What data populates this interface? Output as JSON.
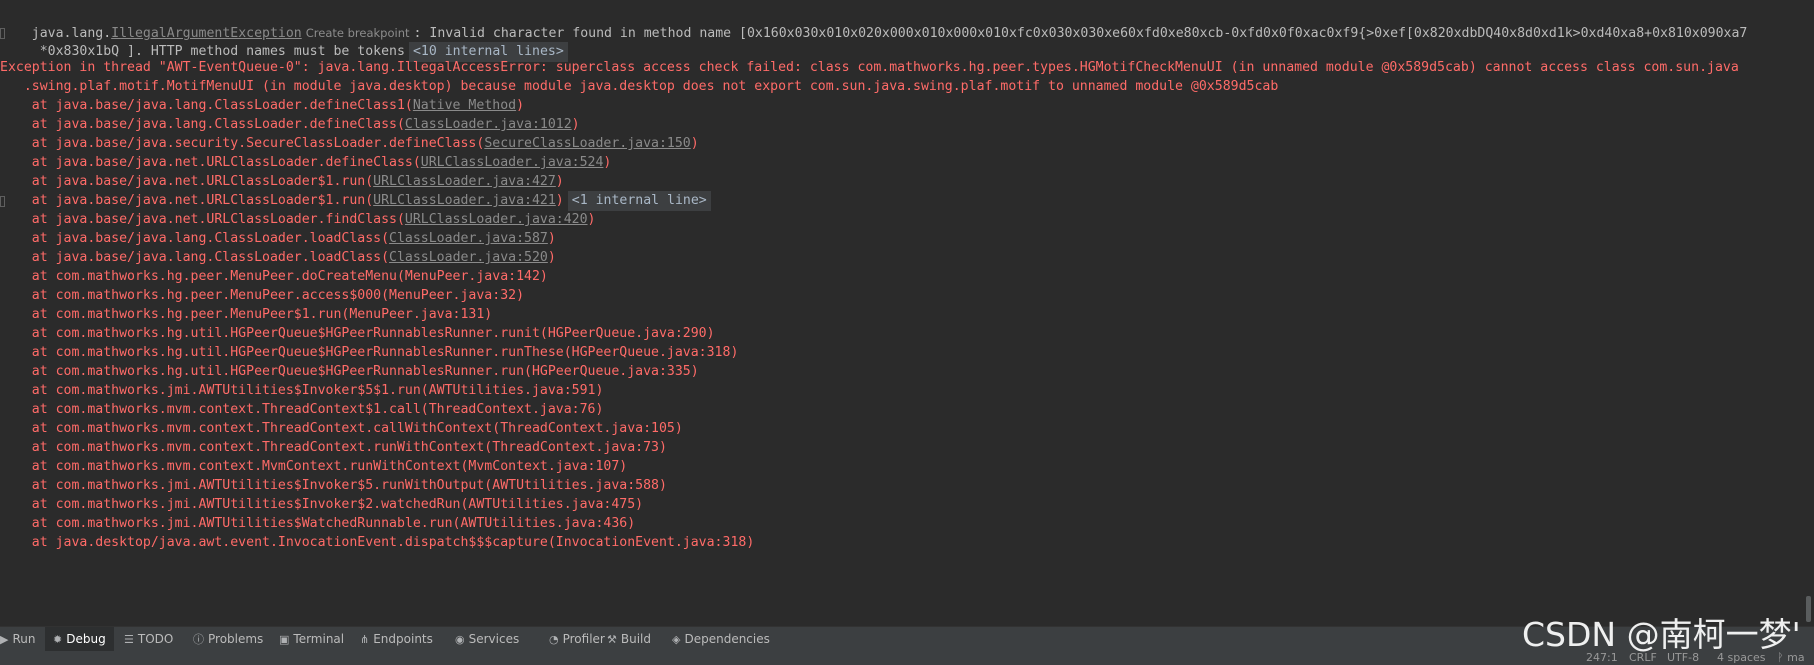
{
  "console": {
    "line1": {
      "prefix": "java.lang.",
      "exception_link": "IllegalArgumentException",
      "breakpoint_label": "Create breakpoint",
      "message": ": Invalid character found in method name [0x160x030x010x020x000x010x000x010xfc0x030x030xe60xfd0xe80xcb-0xfd0x0f0xac0xf9{>0xef[0x820xdbDQ40x8d0xd1k>0xd40xa8+0x810x090xa7"
    },
    "line2": {
      "text": " *0x830x1bQ ]. HTTP method names must be tokens",
      "internal_chip": "<10 internal lines>"
    },
    "exception_line1": "Exception in thread \"AWT-EventQueue-0\": java.lang.IllegalAccessError: superclass access check failed: class com.mathworks.hg.peer.types.HGMotifCheckMenuUI (in unnamed module @0x589d5cab) cannot access class com.sun.java",
    "exception_line2": "   .swing.plaf.motif.MotifMenuUI (in module java.desktop) because module java.desktop does not export com.sun.java.swing.plaf.motif to unnamed module @0x589d5cab",
    "stack": [
      {
        "pre": "    at java.base/java.lang.ClassLoader.defineClass1(",
        "link": "Native Method",
        "post": ")"
      },
      {
        "pre": "    at java.base/java.lang.ClassLoader.defineClass(",
        "link": "ClassLoader.java:1012",
        "post": ")"
      },
      {
        "pre": "    at java.base/java.security.SecureClassLoader.defineClass(",
        "link": "SecureClassLoader.java:150",
        "post": ")"
      },
      {
        "pre": "    at java.base/java.net.URLClassLoader.defineClass(",
        "link": "URLClassLoader.java:524",
        "post": ")"
      },
      {
        "pre": "    at java.base/java.net.URLClassLoader$1.run(",
        "link": "URLClassLoader.java:427",
        "post": ")"
      },
      {
        "pre": "    at java.base/java.net.URLClassLoader$1.run(",
        "link": "URLClassLoader.java:421",
        "post": ")",
        "chip": "<1 internal line>"
      },
      {
        "pre": "    at java.base/java.net.URLClassLoader.findClass(",
        "link": "URLClassLoader.java:420",
        "post": ")"
      },
      {
        "pre": "    at java.base/java.lang.ClassLoader.loadClass(",
        "link": "ClassLoader.java:587",
        "post": ")"
      },
      {
        "pre": "    at java.base/java.lang.ClassLoader.loadClass(",
        "link": "ClassLoader.java:520",
        "post": ")"
      },
      {
        "pre": "    at com.mathworks.hg.peer.MenuPeer.doCreateMenu(MenuPeer.java:142)"
      },
      {
        "pre": "    at com.mathworks.hg.peer.MenuPeer.access$000(MenuPeer.java:32)"
      },
      {
        "pre": "    at com.mathworks.hg.peer.MenuPeer$1.run(MenuPeer.java:131)"
      },
      {
        "pre": "    at com.mathworks.hg.util.HGPeerQueue$HGPeerRunnablesRunner.runit(HGPeerQueue.java:290)"
      },
      {
        "pre": "    at com.mathworks.hg.util.HGPeerQueue$HGPeerRunnablesRunner.runThese(HGPeerQueue.java:318)"
      },
      {
        "pre": "    at com.mathworks.hg.util.HGPeerQueue$HGPeerRunnablesRunner.run(HGPeerQueue.java:335)"
      },
      {
        "pre": "    at com.mathworks.jmi.AWTUtilities$Invoker$5$1.run(AWTUtilities.java:591)"
      },
      {
        "pre": "    at com.mathworks.mvm.context.ThreadContext$1.call(ThreadContext.java:76)"
      },
      {
        "pre": "    at com.mathworks.mvm.context.ThreadContext.callWithContext(ThreadContext.java:105)"
      },
      {
        "pre": "    at com.mathworks.mvm.context.ThreadContext.runWithContext(ThreadContext.java:73)"
      },
      {
        "pre": "    at com.mathworks.mvm.context.MvmContext.runWithContext(MvmContext.java:107)"
      },
      {
        "pre": "    at com.mathworks.jmi.AWTUtilities$Invoker$5.runWithOutput(AWTUtilities.java:588)"
      },
      {
        "pre": "    at com.mathworks.jmi.AWTUtilities$Invoker$2.watchedRun(AWTUtilities.java:475)"
      },
      {
        "pre": "    at com.mathworks.jmi.AWTUtilities$WatchedRunnable.run(AWTUtilities.java:436)"
      },
      {
        "pre": "    at java.desktop/java.awt.event.InvocationEvent.dispatch$$$capture(InvocationEvent.java:318)"
      }
    ]
  },
  "toolbar": {
    "items": [
      {
        "label": "Run",
        "icon": "run-icon"
      },
      {
        "label": "Debug",
        "icon": "bug-icon"
      },
      {
        "label": "TODO",
        "icon": "list-icon"
      },
      {
        "label": "Problems",
        "icon": "info-icon"
      },
      {
        "label": "Terminal",
        "icon": "terminal-icon"
      },
      {
        "label": "Endpoints",
        "icon": "endpoints-icon"
      },
      {
        "label": "Services",
        "icon": "services-icon"
      },
      {
        "label": "Profiler",
        "icon": "profiler-icon"
      },
      {
        "label": "Build",
        "icon": "hammer-icon"
      },
      {
        "label": "Dependencies",
        "icon": "dependencies-icon"
      }
    ]
  },
  "statusbar": {
    "position": "247:1",
    "line_separator": "CRLF",
    "encoding": "UTF-8",
    "indent": "4 spaces",
    "branch_icon": "branch-icon",
    "branch": "ma"
  },
  "watermark": "CSDN @南柯一梦'",
  "colors": {
    "background": "#2b2b2b",
    "error": "#ff6b68",
    "normal_text": "#bbbbbb",
    "link": "#8a8a8a",
    "toolbar": "#3c3f41"
  }
}
